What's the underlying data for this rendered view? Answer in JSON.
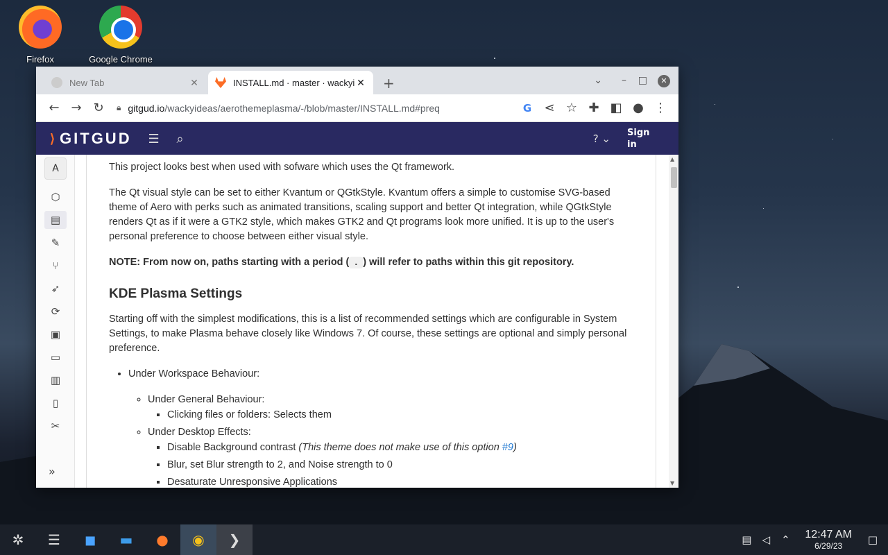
{
  "desktop": {
    "icons": [
      {
        "label": "Firefox",
        "icon": "firefox-icon"
      },
      {
        "label": "Google Chrome",
        "icon": "chrome-icon"
      }
    ]
  },
  "browser": {
    "tabs": [
      {
        "title": "New Tab",
        "active": false
      },
      {
        "title": "INSTALL.md · master · wackyi",
        "active": true,
        "close": "✕"
      }
    ],
    "new_tab": "+",
    "url_host": "gitgud.io",
    "url_path": "/wackyideas/aerothemeplasma/-/blob/master/INSTALL.md#preq"
  },
  "gitlab": {
    "logo": "GITGUD",
    "sign_in": "Sign in",
    "sidebar_avatar": "A",
    "collapse_glyph": "»"
  },
  "doc": {
    "p1": "This project looks best when used with sofware which uses the Qt framework.",
    "p2": "The Qt visual style can be set to either Kvantum or QGtkStyle. Kvantum offers a simple to customise SVG-based theme of Aero with perks such as animated transitions, scaling support and better Qt integration, while QGtkStyle renders Qt as if it were a GTK2 style, which makes GTK2 and Qt programs look more unified. It is up to the user's personal preference to choose between either visual style.",
    "note_before": "NOTE: From now on, paths starting with a period (",
    "note_code": ".",
    "note_after": ") will refer to paths within this git repository.",
    "heading": "KDE Plasma Settings",
    "p3": "Starting off with the simplest modifications, this is a list of recommended settings which are configurable in System Settings, to make Plasma behave closely like Windows 7. Of course, these settings are optional and simply personal preference.",
    "li_workspace": "Under Workspace Behaviour:",
    "li_general": "Under General Behaviour:",
    "li_clicking": "Clicking files or folders: Selects them",
    "li_desktop": "Under Desktop Effects:",
    "li_disable": "Disable Background contrast ",
    "li_disable_em": "(This theme does not make use of this option ",
    "li_disable_link": "#9",
    "li_disable_em_end": ")",
    "li_blur": "Blur, set Blur strength to 2, and Noise strength to 0",
    "li_desaturate": "Desaturate Unresponsive Applications"
  },
  "taskbar": {
    "time": "12:47 AM",
    "date": "6/29/23"
  }
}
